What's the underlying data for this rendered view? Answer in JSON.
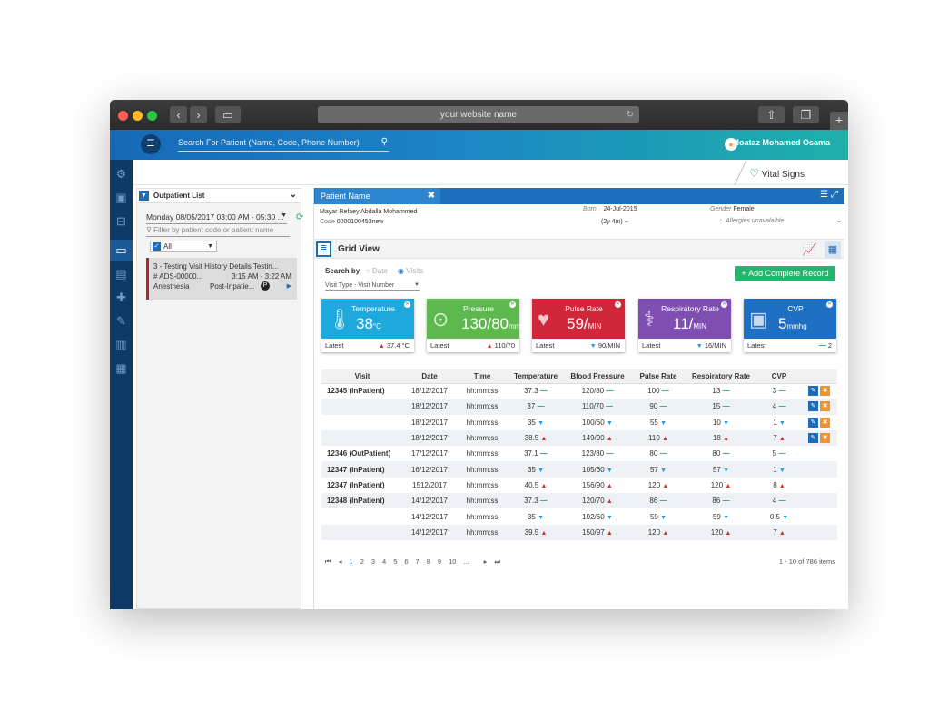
{
  "browser": {
    "address": "your website name"
  },
  "header": {
    "search_placeholder": "Search For Patient (Name, Code, Phone Number)",
    "user_name": "Moataz Mohamed Osama"
  },
  "module": {
    "title": "Vital Signs"
  },
  "outpatient": {
    "title": "Outpatient List",
    "date_range": "Monday 08/05/2017 03:00 AM - 05:30 ...",
    "filter_placeholder": "Filter by patient code or patient name",
    "select_all": "All",
    "item": {
      "title": "3 - Testing Visit History Details Testin...",
      "code": "# ADS-00000...",
      "time": "3:15 AM - 3:22 AM",
      "dept": "Anesthesia",
      "status": "Post-Inpatie...",
      "badge": "P"
    }
  },
  "patient": {
    "tab": "Patient Name",
    "name": "Mayar Refaey Abdalla Mohammed",
    "code_label": "Code",
    "code": "0000100453new",
    "born_label": "Born",
    "born": "24-Jul-2015",
    "age": "(2y 4m)",
    "gender_label": "Gender",
    "gender": "Female",
    "allergies": "Allergies unavalaible"
  },
  "grid": {
    "title": "Grid View",
    "search_by": "Search by",
    "opt_date": "Date",
    "opt_visits": "Visits",
    "visit_type": "Visit Type - Visit Number",
    "add_button": "Add Complete Record"
  },
  "cards": [
    {
      "title": "Temperature",
      "value": "38",
      "unit": "°C",
      "latest_label": "Latest",
      "latest": "37.4 °C",
      "trend": "up",
      "color": "#1fa8dc",
      "icon": "thermometer-icon"
    },
    {
      "title": "Pressure",
      "value": "130/80",
      "unit": "mmhg",
      "latest_label": "Latest",
      "latest": "110/70",
      "trend": "up",
      "color": "#5db84e",
      "icon": "blood-pressure-icon"
    },
    {
      "title": "Pulse Rate",
      "value": "59/",
      "unit": "MIN",
      "latest_label": "Latest",
      "latest": "90/MIN",
      "trend": "down",
      "color": "#d0283a",
      "icon": "heart-pulse-icon"
    },
    {
      "title": "Respiratory Rate",
      "value": "11/",
      "unit": "MIN",
      "latest_label": "Latest",
      "latest": "16/MIN",
      "trend": "down",
      "color": "#7e4fb0",
      "icon": "lungs-icon"
    },
    {
      "title": "CVP",
      "value": "5",
      "unit": "mmhg",
      "latest_label": "Latest",
      "latest": "2",
      "trend": "equal",
      "color": "#1f6fc4",
      "icon": "cvp-monitor-icon"
    }
  ],
  "table": {
    "headers": [
      "Visit",
      "Date",
      "Time",
      "Temperature",
      "Blood Pressure",
      "Pulse Rate",
      "Respiratory Rate",
      "CVP"
    ],
    "rows": [
      {
        "visit": "12345 (InPatient)",
        "date": "18/12/2017",
        "time": "hh:mm:ss",
        "temp": "37.3",
        "tt": "eq",
        "bp": "120/80",
        "bt": "eq",
        "pulse": "100",
        "pt": "eq",
        "resp": "13",
        "rt": "eq",
        "cvp": "3",
        "ct": "eq",
        "actions": true
      },
      {
        "visit": "",
        "date": "18/12/2017",
        "time": "hh:mm:ss",
        "temp": "37",
        "tt": "eq",
        "bp": "110/70",
        "bt": "eq",
        "pulse": "90",
        "pt": "eq",
        "resp": "15",
        "rt": "eq",
        "cvp": "4",
        "ct": "eq",
        "actions": true
      },
      {
        "visit": "",
        "date": "18/12/2017",
        "time": "hh:mm:ss",
        "temp": "35",
        "tt": "dn",
        "bp": "100/60",
        "bt": "dn",
        "pulse": "55",
        "pt": "dn",
        "resp": "10",
        "rt": "dn",
        "cvp": "1",
        "ct": "dn",
        "actions": true
      },
      {
        "visit": "",
        "date": "18/12/2017",
        "time": "hh:mm:ss",
        "temp": "38.5",
        "tt": "up",
        "bp": "149/90",
        "bt": "up",
        "pulse": "110",
        "pt": "up",
        "resp": "18",
        "rt": "up",
        "cvp": "7",
        "ct": "up",
        "actions": true
      },
      {
        "visit": "12346 (OutPatient)",
        "date": "17/12/2017",
        "time": "hh:mm:ss",
        "temp": "37.1",
        "tt": "eq",
        "bp": "123/80",
        "bt": "eq",
        "pulse": "80",
        "pt": "eq",
        "resp": "80",
        "rt": "eq",
        "cvp": "5",
        "ct": "eq",
        "actions": false
      },
      {
        "visit": "12347 (InPatient)",
        "date": "16/12/2017",
        "time": "hh:mm:ss",
        "temp": "35",
        "tt": "dn",
        "bp": "105/60",
        "bt": "dn",
        "pulse": "57",
        "pt": "dn",
        "resp": "57",
        "rt": "dn",
        "cvp": "1",
        "ct": "dn",
        "actions": false
      },
      {
        "visit": "12347 (InPatient)",
        "date": "1512/2017",
        "time": "hh:mm:ss",
        "temp": "40.5",
        "tt": "up",
        "bp": "156/90",
        "bt": "up",
        "pulse": "120",
        "pt": "up",
        "resp": "120",
        "rt": "up",
        "cvp": "8",
        "ct": "up",
        "actions": false
      },
      {
        "visit": "12348 (InPatient)",
        "date": "14/12/2017",
        "time": "hh:mm:ss",
        "temp": "37.3",
        "tt": "eq",
        "bp": "120/70",
        "bt": "up",
        "pulse": "86",
        "pt": "eq",
        "resp": "86",
        "rt": "eq",
        "cvp": "4",
        "ct": "eq",
        "actions": false
      },
      {
        "visit": "",
        "date": "14/12/2017",
        "time": "hh:mm:ss",
        "temp": "35",
        "tt": "dn",
        "bp": "102/60",
        "bt": "dn",
        "pulse": "59",
        "pt": "dn",
        "resp": "59",
        "rt": "dn",
        "cvp": "0.5",
        "ct": "dn",
        "actions": false
      },
      {
        "visit": "",
        "date": "14/12/2017",
        "time": "hh:mm:ss",
        "temp": "39.5",
        "tt": "up",
        "bp": "150/97",
        "bt": "up",
        "pulse": "120",
        "pt": "up",
        "resp": "120",
        "rt": "up",
        "cvp": "7",
        "ct": "up",
        "actions": false
      }
    ]
  },
  "pager": {
    "pages": [
      "1",
      "2",
      "3",
      "4",
      "5",
      "6",
      "7",
      "8",
      "9",
      "10",
      "..."
    ],
    "current": "1",
    "info": "1 - 10 of 786 items"
  },
  "trend_symbols": {
    "up": "▲",
    "dn": "▼",
    "eq": "—"
  }
}
